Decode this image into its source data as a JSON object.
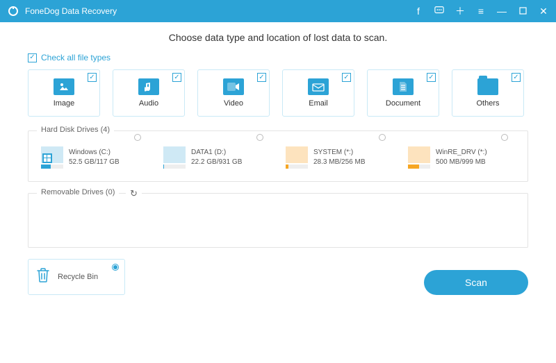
{
  "app": {
    "title": "FoneDog Data Recovery"
  },
  "instruction": "Choose data type and location of lost data to scan.",
  "checkall": {
    "label": "Check all file types"
  },
  "types": [
    {
      "label": "Image"
    },
    {
      "label": "Audio"
    },
    {
      "label": "Video"
    },
    {
      "label": "Email"
    },
    {
      "label": "Document"
    },
    {
      "label": "Others"
    }
  ],
  "hdd": {
    "title": "Hard Disk Drives (4)",
    "items": [
      {
        "name": "Windows (C:)",
        "size": "52.5 GB/117 GB",
        "fill": 45,
        "color": "#2ca3d6",
        "block": "#cfe9f5",
        "os": true
      },
      {
        "name": "DATA1 (D:)",
        "size": "22.2 GB/931 GB",
        "fill": 4,
        "color": "#2ca3d6",
        "block": "#cfe9f5",
        "os": false
      },
      {
        "name": "SYSTEM (*:)",
        "size": "28.3 MB/256 MB",
        "fill": 12,
        "color": "#f6a623",
        "block": "#fde3be",
        "os": false
      },
      {
        "name": "WinRE_DRV (*:)",
        "size": "500 MB/999 MB",
        "fill": 50,
        "color": "#f6a623",
        "block": "#fde3be",
        "os": false
      }
    ]
  },
  "removable": {
    "title": "Removable Drives (0)"
  },
  "recycle": {
    "label": "Recycle Bin"
  },
  "scan": {
    "label": "Scan"
  }
}
